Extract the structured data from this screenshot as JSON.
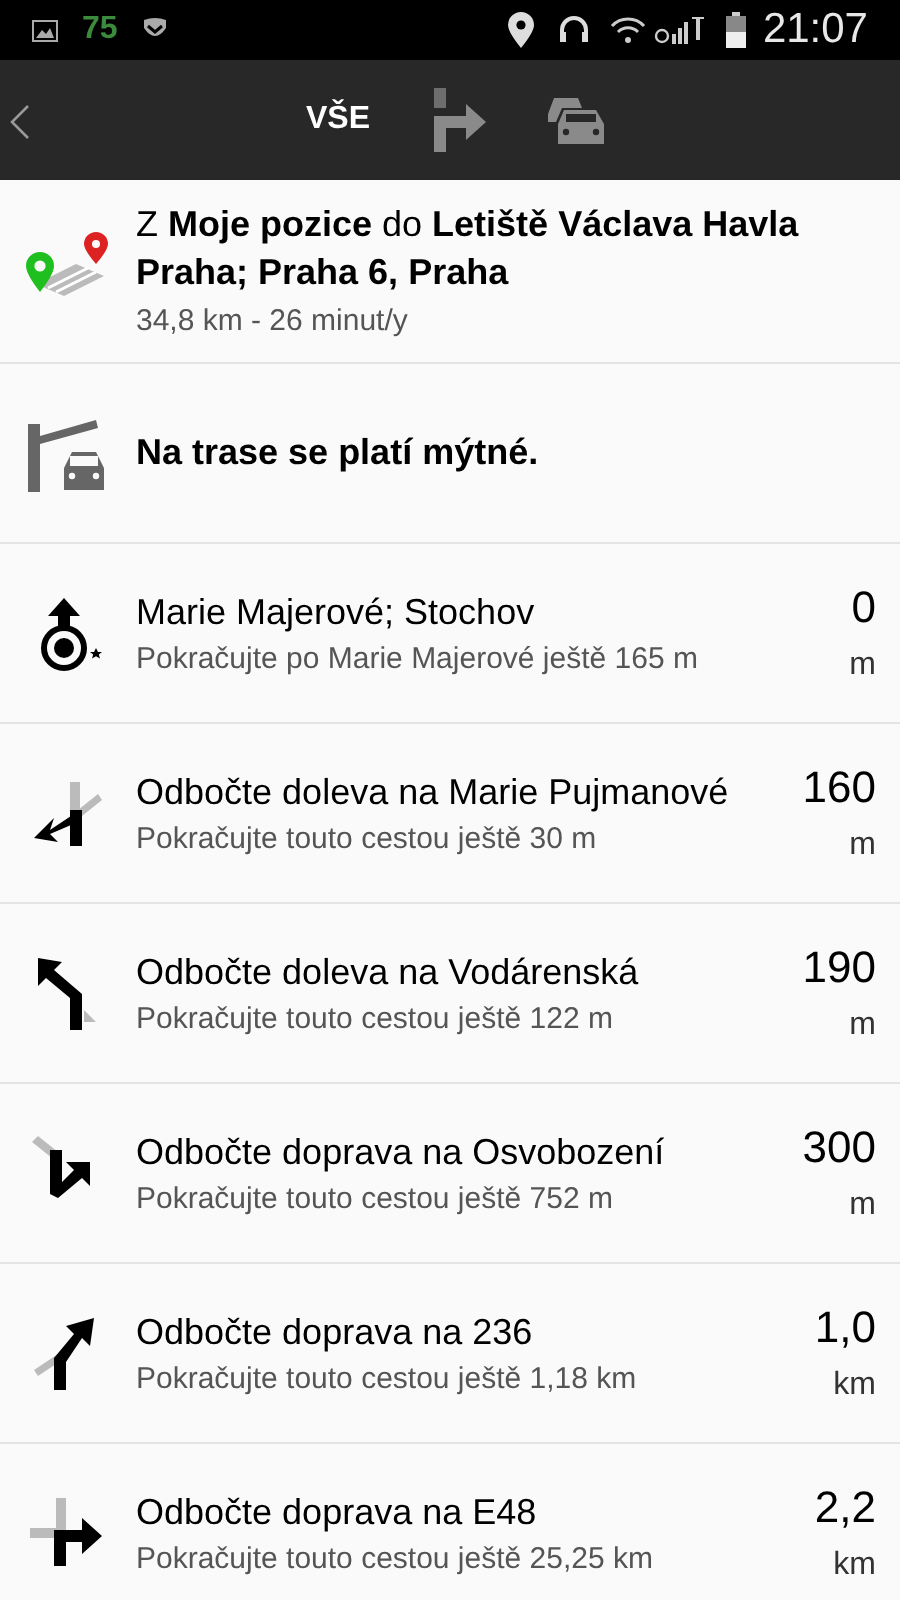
{
  "status_bar": {
    "battery_level_text": "75",
    "time": "21:07"
  },
  "tabs": [
    {
      "kind": "text",
      "label": "VŠE",
      "selected": true
    },
    {
      "kind": "turns",
      "selected": false
    },
    {
      "kind": "traffic",
      "selected": false
    }
  ],
  "summary": {
    "route": "Z **Moje pozice** do **Letiště Václava Havla Praha; Praha 6, Praha**",
    "details": "34,8 km - 26 minut/y"
  },
  "toll_notice": "Na trase se platí mýtné.",
  "steps": [
    {
      "kind": "start",
      "title": "Marie Majerové; Stochov",
      "detail": "Pokračujte po Marie Majerové ještě 165 m",
      "distance": "0",
      "unit": "m"
    },
    {
      "kind": "sharp_left",
      "title": "Odbočte doleva na Marie Pujmanové",
      "detail": "Pokračujte touto cestou ještě 30 m",
      "distance": "160",
      "unit": "m"
    },
    {
      "kind": "left",
      "title": "Odbočte doleva na Vodárenská",
      "detail": "Pokračujte touto cestou ještě 122 m",
      "distance": "190",
      "unit": "m"
    },
    {
      "kind": "sharp_right",
      "title": "Odbočte doprava na Osvobození",
      "detail": "Pokračujte touto cestou ještě 752 m",
      "distance": "300",
      "unit": "m"
    },
    {
      "kind": "slight_right",
      "title": "Odbočte doprava na 236",
      "detail": "Pokračujte touto cestou ještě 1,18 km",
      "distance": "1,0",
      "unit": "km"
    },
    {
      "kind": "right",
      "title": "Odbočte doprava na E48",
      "detail": "Pokračujte touto cestou ještě 25,25 km",
      "distance": "2,2",
      "unit": "km"
    }
  ]
}
